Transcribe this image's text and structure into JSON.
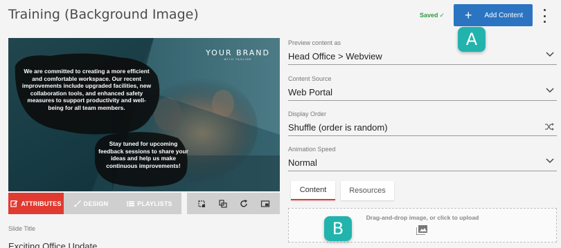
{
  "header": {
    "title": "Training (Background Image)",
    "saved_label": "Saved",
    "saved_check": "✓",
    "add_button_label": "Add Content",
    "add_button_icon": "plus-icon",
    "more_icon": "kebab-menu-icon"
  },
  "badges": {
    "a": "A",
    "b": "B"
  },
  "preview": {
    "brand_name": "YOUR BRAND",
    "brand_tagline": "WITH TAGLINE",
    "message_1": "We are committed to creating a more efficient and comfortable workspace. Our recent improvements include upgraded facilities, new collaboration tools, and enhanced safety measures to support productivity and well-being for all team members.",
    "message_2": "Stay tuned for upcoming feedback sessions to share your ideas and help us make continuous improvements!"
  },
  "tabs": {
    "attributes": "ATTRIBUTES",
    "design": "DESIGN",
    "playlists": "PLAYLISTS",
    "tools": [
      "crop-icon",
      "layers-icon",
      "refresh-icon",
      "picture-in-picture-icon"
    ]
  },
  "slide_title": {
    "label": "Slide Title",
    "value": "Exciting Office Update"
  },
  "fields": {
    "preview_as": {
      "label": "Preview content as",
      "value": "Head Office > Webview"
    },
    "content_source": {
      "label": "Content Source",
      "value": "Web Portal"
    },
    "display_order": {
      "label": "Display Order",
      "value": "Shuffle (order is random)"
    },
    "animation_speed": {
      "label": "Animation Speed",
      "value": "Normal"
    }
  },
  "content_tabs": {
    "content": "Content",
    "resources": "Resources",
    "active": "Content"
  },
  "dropzone": {
    "text": "Drag-and-drop image, or click to upload",
    "icon": "image-icon"
  },
  "colors": {
    "accent_blue": "#2b74c2",
    "accent_red": "#e03a31",
    "badge_teal": "#22b3ad",
    "saved_green": "#2e9b45"
  }
}
